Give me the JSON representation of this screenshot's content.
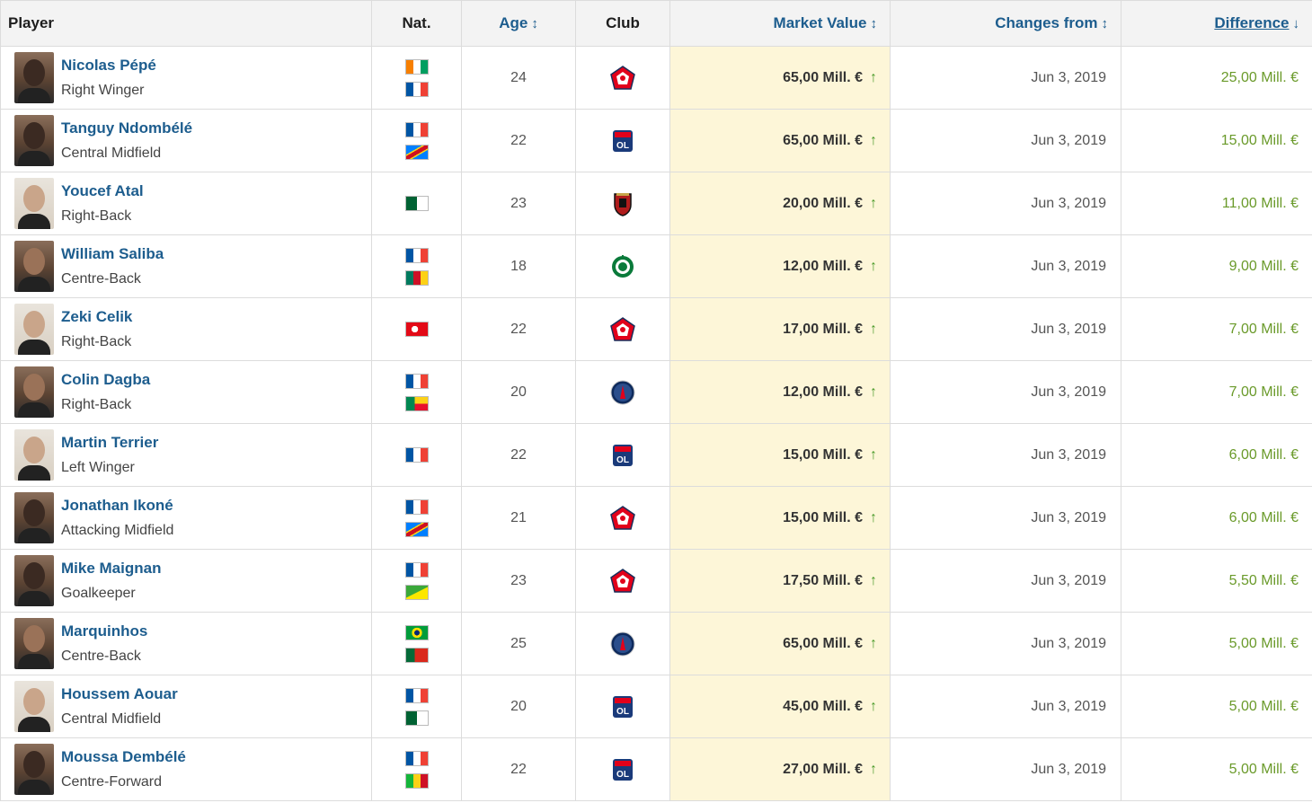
{
  "header": {
    "player": "Player",
    "nat": "Nat.",
    "age": "Age",
    "club": "Club",
    "market_value": "Market Value",
    "changes_from": "Changes from",
    "difference": "Difference"
  },
  "sort_icons": {
    "neutral": "↕",
    "desc": "↓"
  },
  "colors": {
    "link": "#1d5d8e",
    "highlight": "#fdf6d8",
    "up_arrow": "#4a9a2a",
    "diff_text": "#6a9a2a"
  },
  "rows": [
    {
      "name": "Nicolas Pépé",
      "position": "Right Winger",
      "flags": [
        "ivory-coast",
        "france"
      ],
      "age": "24",
      "club": "lille",
      "market_value": "65,00 Mill. €",
      "trend": "↑",
      "changes_from": "Jun 3, 2019",
      "difference": "25,00 Mill. €"
    },
    {
      "name": "Tanguy Ndombélé",
      "position": "Central Midfield",
      "flags": [
        "france",
        "dr-congo"
      ],
      "age": "22",
      "club": "lyon",
      "market_value": "65,00 Mill. €",
      "trend": "↑",
      "changes_from": "Jun 3, 2019",
      "difference": "15,00 Mill. €"
    },
    {
      "name": "Youcef Atal",
      "position": "Right-Back",
      "flags": [
        "algeria"
      ],
      "age": "23",
      "club": "nice",
      "market_value": "20,00 Mill. €",
      "trend": "↑",
      "changes_from": "Jun 3, 2019",
      "difference": "11,00 Mill. €"
    },
    {
      "name": "William Saliba",
      "position": "Centre-Back",
      "flags": [
        "france",
        "cameroon"
      ],
      "age": "18",
      "club": "saint-etienne",
      "market_value": "12,00 Mill. €",
      "trend": "↑",
      "changes_from": "Jun 3, 2019",
      "difference": "9,00 Mill. €"
    },
    {
      "name": "Zeki Celik",
      "position": "Right-Back",
      "flags": [
        "turkey"
      ],
      "age": "22",
      "club": "lille",
      "market_value": "17,00 Mill. €",
      "trend": "↑",
      "changes_from": "Jun 3, 2019",
      "difference": "7,00 Mill. €"
    },
    {
      "name": "Colin Dagba",
      "position": "Right-Back",
      "flags": [
        "france",
        "benin"
      ],
      "age": "20",
      "club": "psg",
      "market_value": "12,00 Mill. €",
      "trend": "↑",
      "changes_from": "Jun 3, 2019",
      "difference": "7,00 Mill. €"
    },
    {
      "name": "Martin Terrier",
      "position": "Left Winger",
      "flags": [
        "france"
      ],
      "age": "22",
      "club": "lyon",
      "market_value": "15,00 Mill. €",
      "trend": "↑",
      "changes_from": "Jun 3, 2019",
      "difference": "6,00 Mill. €"
    },
    {
      "name": "Jonathan Ikoné",
      "position": "Attacking Midfield",
      "flags": [
        "france",
        "dr-congo"
      ],
      "age": "21",
      "club": "lille",
      "market_value": "15,00 Mill. €",
      "trend": "↑",
      "changes_from": "Jun 3, 2019",
      "difference": "6,00 Mill. €"
    },
    {
      "name": "Mike Maignan",
      "position": "Goalkeeper",
      "flags": [
        "france",
        "french-guiana"
      ],
      "age": "23",
      "club": "lille",
      "market_value": "17,50 Mill. €",
      "trend": "↑",
      "changes_from": "Jun 3, 2019",
      "difference": "5,50 Mill. €"
    },
    {
      "name": "Marquinhos",
      "position": "Centre-Back",
      "flags": [
        "brazil",
        "portugal"
      ],
      "age": "25",
      "club": "psg",
      "market_value": "65,00 Mill. €",
      "trend": "↑",
      "changes_from": "Jun 3, 2019",
      "difference": "5,00 Mill. €"
    },
    {
      "name": "Houssem Aouar",
      "position": "Central Midfield",
      "flags": [
        "france",
        "algeria"
      ],
      "age": "20",
      "club": "lyon",
      "market_value": "45,00 Mill. €",
      "trend": "↑",
      "changes_from": "Jun 3, 2019",
      "difference": "5,00 Mill. €"
    },
    {
      "name": "Moussa Dembélé",
      "position": "Centre-Forward",
      "flags": [
        "france",
        "mali"
      ],
      "age": "22",
      "club": "lyon",
      "market_value": "27,00 Mill. €",
      "trend": "↑",
      "changes_from": "Jun 3, 2019",
      "difference": "5,00 Mill. €"
    }
  ]
}
